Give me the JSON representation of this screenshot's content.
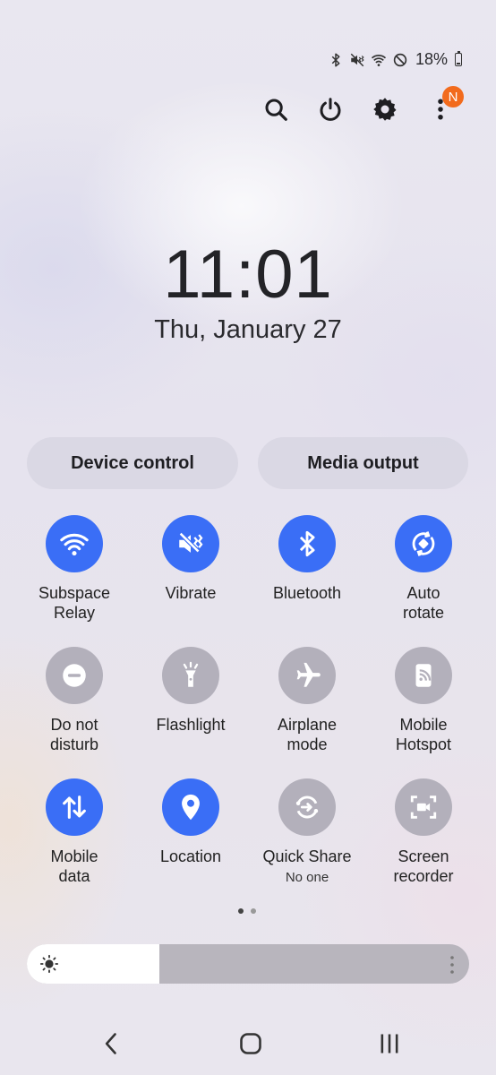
{
  "status": {
    "icons": [
      "bluetooth-icon",
      "vibrate-icon",
      "wifi-icon",
      "do-not-disturb-icon"
    ],
    "battery_text": "18%",
    "battery_level": 0.18
  },
  "top_actions": {
    "icons": [
      "search-icon",
      "power-icon",
      "gear-icon",
      "more-vert-icon"
    ],
    "notification_badge": "N",
    "badge_color": "#f26b1d"
  },
  "clock": {
    "time": "11:01",
    "date": "Thu, January 27"
  },
  "pills": {
    "device_control": "Device control",
    "media_output": "Media output"
  },
  "colors": {
    "active": "#3a6ef6",
    "inactive": "#b3b0bb"
  },
  "tiles": [
    {
      "label": "Subspace\nRelay",
      "icon": "wifi-icon",
      "active": true
    },
    {
      "label": "Vibrate",
      "icon": "vibrate-icon",
      "active": true
    },
    {
      "label": "Bluetooth",
      "icon": "bluetooth-icon",
      "active": true
    },
    {
      "label": "Auto\nrotate",
      "icon": "auto-rotate-icon",
      "active": true
    },
    {
      "label": "Do not\ndisturb",
      "icon": "do-not-disturb-icon",
      "active": false
    },
    {
      "label": "Flashlight",
      "icon": "flashlight-icon",
      "active": false
    },
    {
      "label": "Airplane\nmode",
      "icon": "airplane-icon",
      "active": false
    },
    {
      "label": "Mobile\nHotspot",
      "icon": "hotspot-icon",
      "active": false
    },
    {
      "label": "Mobile\ndata",
      "icon": "mobile-data-icon",
      "active": true
    },
    {
      "label": "Location",
      "icon": "location-icon",
      "active": true
    },
    {
      "label": "Quick Share",
      "sublabel": "No one",
      "icon": "quick-share-icon",
      "active": false
    },
    {
      "label": "Screen\nrecorder",
      "icon": "screen-recorder-icon",
      "active": false
    }
  ],
  "pager": {
    "pages": 2,
    "current": 1
  },
  "brightness": {
    "level": 0.3
  },
  "nav": {
    "icons": [
      "back-icon",
      "home-icon",
      "recents-icon"
    ]
  }
}
